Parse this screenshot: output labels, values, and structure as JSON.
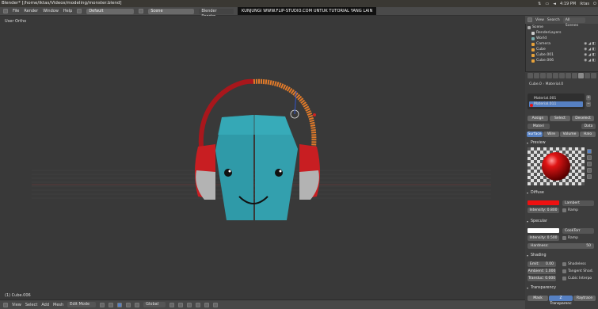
{
  "window": {
    "title": "Blender* [/home/iktas/Videos/modeling/monster.blend]",
    "time": "4:19 PM",
    "user": "iktas"
  },
  "menu": {
    "items": [
      "File",
      "Render",
      "Window",
      "Help"
    ],
    "layout": "Default",
    "scene": "Scene",
    "engine": "Blender Render"
  },
  "banner": {
    "text": "KUNJUNGI WWW.FLIP-STUDIO.COM UNTUK TUTORIAL YANG LAIN"
  },
  "viewport": {
    "label": "User Ortho",
    "object": "(1) Cube.006"
  },
  "header3d": {
    "view": "View",
    "select": "Select",
    "add": "Add",
    "mesh": "Mesh",
    "mode": "Edit Mode",
    "orientation": "Global"
  },
  "outliner": {
    "tabs": [
      "View",
      "Search",
      "All Scenes"
    ],
    "items": [
      "Scene",
      "RenderLayers",
      "World",
      "Camera",
      "Cube",
      "Cube.001",
      "Cube.006"
    ]
  },
  "properties": {
    "object": "Cube.0",
    "material": "Material.0",
    "slots": [
      "Material.001",
      "Material.011"
    ],
    "slot_buttons": [
      "Assign",
      "Select",
      "Deselect"
    ],
    "mat_field": "Materi",
    "data_label": "Data",
    "tabs": [
      "Surface",
      "Wire",
      "Volume",
      "Halo"
    ],
    "preview": "Preview",
    "diffuse": {
      "label": "Diffuse",
      "shader": "Lambert",
      "intensity": "Intensity: 0.800",
      "ramp": "Ramp"
    },
    "specular": {
      "label": "Specular",
      "shader": "CookTorr",
      "intensity": "Intensity: 0.500",
      "ramp": "Ramp",
      "hardness": "Hardness:",
      "hardness_val": "50"
    },
    "shading": {
      "label": "Shading",
      "emit": "Emit:",
      "emit_val": "0.00",
      "ambient": "Ambient: 1.000",
      "translucency": "Transluc: 0.000",
      "shadeless": "Shadeless",
      "tangent": "Tangent Shad.",
      "cubic": "Cubic Interpo"
    },
    "transparency": {
      "label": "Transparency"
    },
    "bottom": [
      "Mask",
      "Z Transparenc",
      "Raytrace"
    ]
  },
  "colors": {
    "diffuse": "#ee1111",
    "specular": "#ffffff",
    "head": "#2f9aa8",
    "cup": "#c81e22",
    "band": "#a8171c",
    "band_sel": "#e07a2a"
  }
}
